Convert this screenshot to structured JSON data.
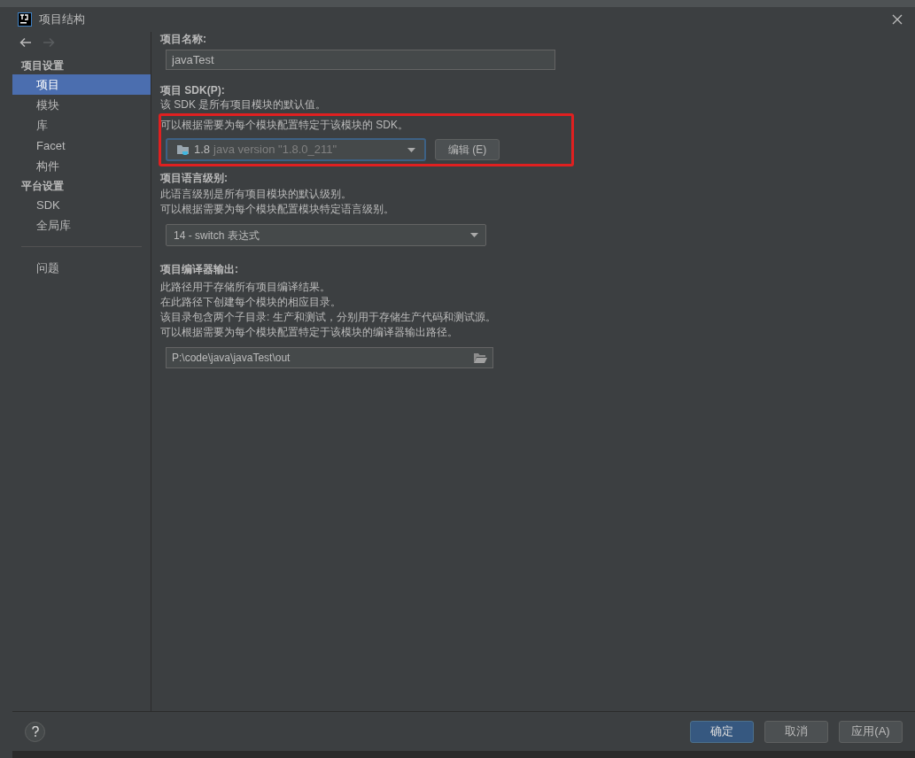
{
  "window": {
    "title": "项目结构"
  },
  "sidebar": {
    "groups": [
      {
        "title": "项目设置",
        "items": [
          {
            "label": "项目",
            "selected": true
          },
          {
            "label": "模块",
            "selected": false
          },
          {
            "label": "库",
            "selected": false
          },
          {
            "label": "Facet",
            "selected": false
          },
          {
            "label": "构件",
            "selected": false
          }
        ]
      },
      {
        "title": "平台设置",
        "items": [
          {
            "label": "SDK",
            "selected": false
          },
          {
            "label": "全局库",
            "selected": false
          }
        ]
      }
    ],
    "extra_items": [
      {
        "label": "问题",
        "selected": false
      }
    ]
  },
  "project_name": {
    "label": "项目名称:",
    "value": "javaTest"
  },
  "project_sdk": {
    "label": "项目 SDK(P):",
    "description": [
      "该 SDK 是所有项目模块的默认值。",
      "可以根据需要为每个模块配置特定于该模块的 SDK。"
    ],
    "version": "1.8",
    "detail": "java version \"1.8.0_211\"",
    "edit_button": "编辑 (E)",
    "highlighted": true
  },
  "language_level": {
    "label": "项目语言级别:",
    "description": [
      "此语言级别是所有项目模块的默认级别。",
      "可以根据需要为每个模块配置模块特定语言级别。"
    ],
    "value": "14 - switch 表达式"
  },
  "compiler_output": {
    "label": "项目编译器输出:",
    "description": [
      "此路径用于存储所有项目编译结果。",
      "在此路径下创建每个模块的相应目录。",
      "该目录包含两个子目录: 生产和测试，分别用于存储生产代码和测试源。",
      "可以根据需要为每个模块配置特定于该模块的编译器输出路径。"
    ],
    "value": "P:\\code\\java\\javaTest\\out"
  },
  "buttons": [
    {
      "label": "确定",
      "kind": "primary"
    },
    {
      "label": "取消",
      "kind": "normal"
    },
    {
      "label": "应用(A)",
      "kind": "normal"
    }
  ]
}
